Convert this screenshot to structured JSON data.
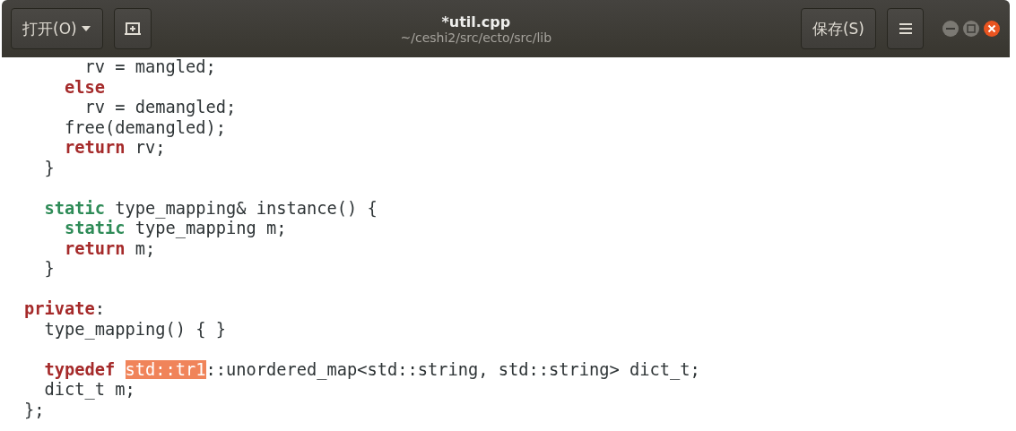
{
  "header": {
    "open_button": "打开(O)",
    "title": "*util.cpp",
    "subtitle": "~/ceshi2/src/ecto/src/lib",
    "save_button": "保存(S)"
  },
  "code": [
    {
      "kind": "code",
      "segments": [
        {
          "kind": "plain",
          "text": "      rv = mangled;"
        }
      ]
    },
    {
      "kind": "code",
      "segments": [
        {
          "kind": "keyword",
          "text": "    else"
        }
      ]
    },
    {
      "kind": "code",
      "segments": [
        {
          "kind": "plain",
          "text": "      rv = demangled;"
        }
      ]
    },
    {
      "kind": "code",
      "segments": [
        {
          "kind": "plain",
          "text": "    free(demangled);"
        }
      ]
    },
    {
      "kind": "code",
      "segments": [
        {
          "kind": "keyword",
          "text": "    return"
        },
        {
          "kind": "plain",
          "text": " rv;"
        }
      ]
    },
    {
      "kind": "code",
      "segments": [
        {
          "kind": "plain",
          "text": "  }"
        }
      ]
    },
    {
      "kind": "blank"
    },
    {
      "kind": "code",
      "segments": [
        {
          "kind": "type",
          "text": "  static"
        },
        {
          "kind": "plain",
          "text": " type_mapping& instance() {"
        }
      ]
    },
    {
      "kind": "code",
      "segments": [
        {
          "kind": "type",
          "text": "    static"
        },
        {
          "kind": "plain",
          "text": " type_mapping m;"
        }
      ]
    },
    {
      "kind": "code",
      "segments": [
        {
          "kind": "keyword",
          "text": "    return"
        },
        {
          "kind": "plain",
          "text": " m;"
        }
      ]
    },
    {
      "kind": "code",
      "segments": [
        {
          "kind": "plain",
          "text": "  }"
        }
      ]
    },
    {
      "kind": "blank"
    },
    {
      "kind": "code",
      "segments": [
        {
          "kind": "keyword",
          "text": "private"
        },
        {
          "kind": "plain",
          "text": ":"
        }
      ]
    },
    {
      "kind": "code",
      "segments": [
        {
          "kind": "plain",
          "text": "  type_mapping() { }"
        }
      ]
    },
    {
      "kind": "blank"
    },
    {
      "kind": "code",
      "segments": [
        {
          "kind": "keyword",
          "text": "  typedef "
        },
        {
          "kind": "selection",
          "text": "std::tr1"
        },
        {
          "kind": "plain",
          "text": "::unordered_map<std::string, std::string> dict_t;"
        }
      ]
    },
    {
      "kind": "code",
      "segments": [
        {
          "kind": "plain",
          "text": "  dict_t m;"
        }
      ]
    },
    {
      "kind": "code",
      "segments": [
        {
          "kind": "plain",
          "text": "};"
        }
      ]
    }
  ]
}
